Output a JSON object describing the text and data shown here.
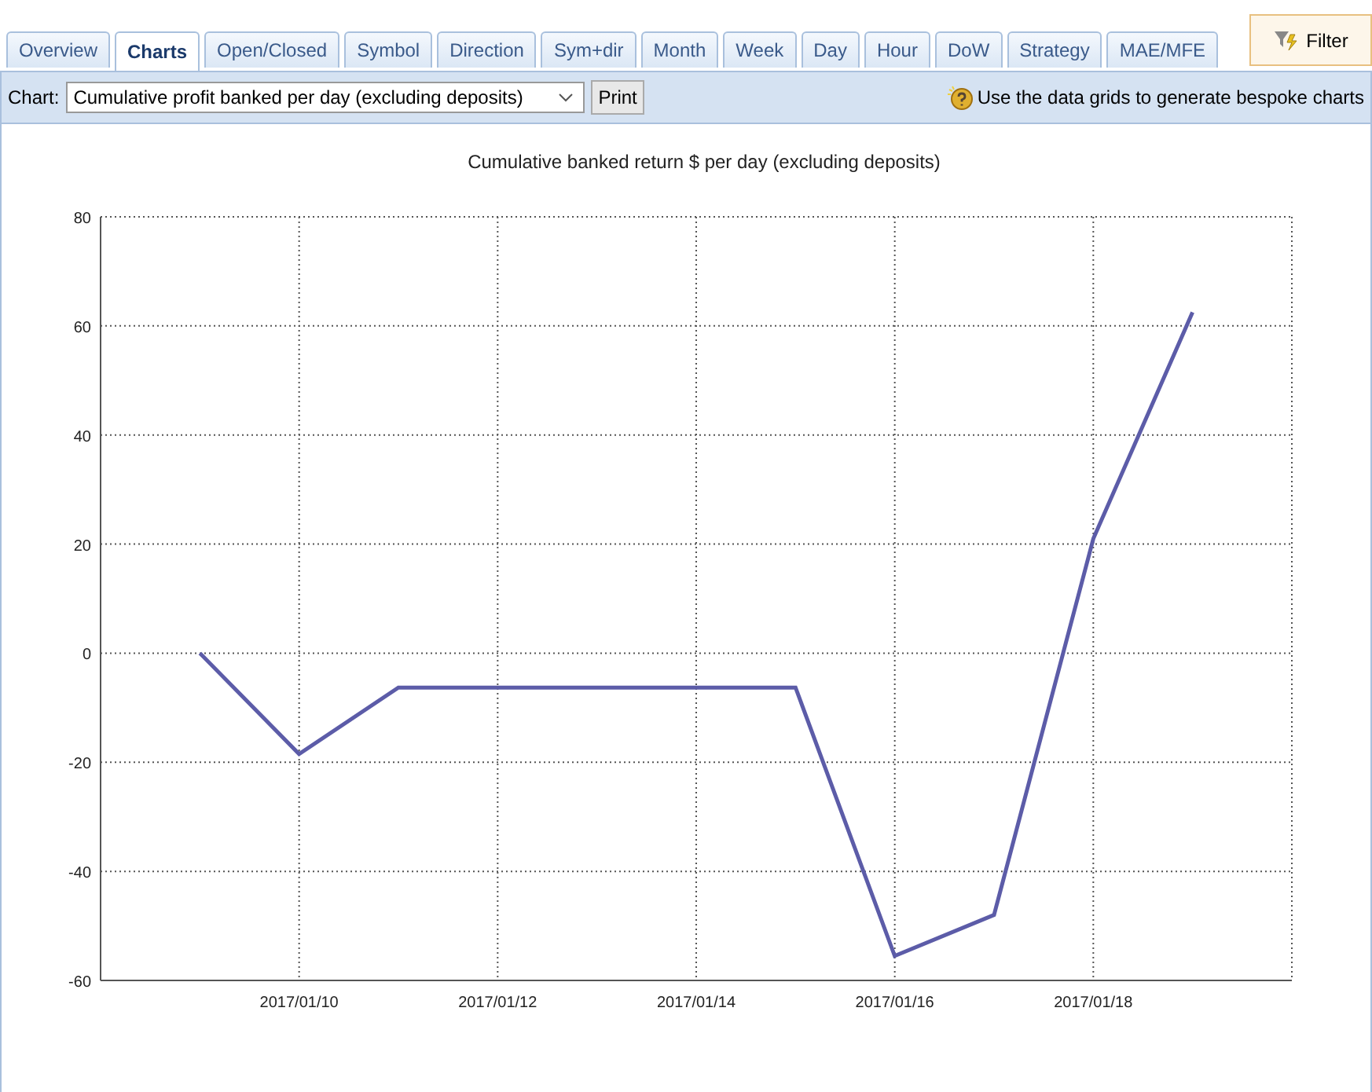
{
  "tabs": [
    {
      "label": "Overview",
      "selected": false
    },
    {
      "label": "Charts",
      "selected": true
    },
    {
      "label": "Open/Closed",
      "selected": false
    },
    {
      "label": "Symbol",
      "selected": false
    },
    {
      "label": "Direction",
      "selected": false
    },
    {
      "label": "Sym+dir",
      "selected": false
    },
    {
      "label": "Month",
      "selected": false
    },
    {
      "label": "Week",
      "selected": false
    },
    {
      "label": "Day",
      "selected": false
    },
    {
      "label": "Hour",
      "selected": false
    },
    {
      "label": "DoW",
      "selected": false
    },
    {
      "label": "Strategy",
      "selected": false
    },
    {
      "label": "MAE/MFE",
      "selected": false
    }
  ],
  "filter_button": "Filter",
  "toolbar": {
    "chart_label": "Chart:",
    "chart_select": "Cumulative profit banked per day (excluding deposits)",
    "print_button": "Print",
    "hint": "Use the data grids to generate bespoke charts"
  },
  "chart": {
    "chart_data": {
      "type": "line",
      "title": "Cumulative banked return $ per day (excluding deposits)",
      "categories": [
        null,
        "2017/01/10",
        null,
        "2017/01/12",
        null,
        "2017/01/14",
        null,
        "2017/01/16",
        null,
        "2017/01/18",
        null
      ],
      "series": [
        {
          "color": "#5c5ca8",
          "values": [
            0,
            -18.5,
            -6.3,
            -6.3,
            -6.3,
            -6.3,
            -6.3,
            -55.5,
            -48,
            21,
            62.5
          ]
        }
      ],
      "ylim": [
        -60,
        80
      ],
      "grid": true,
      "yticks": [
        -60,
        -40,
        -20,
        0,
        20,
        40,
        60,
        80
      ]
    }
  }
}
